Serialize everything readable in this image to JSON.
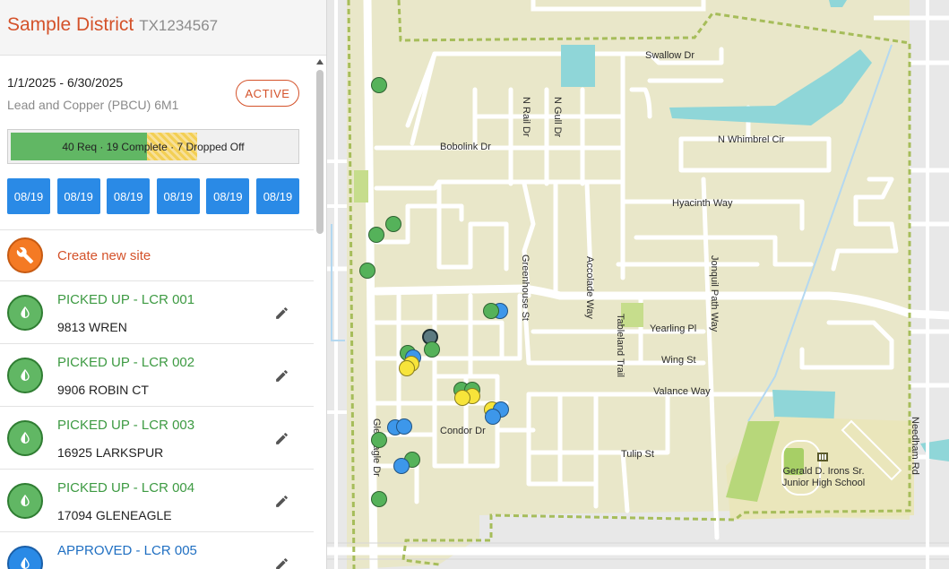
{
  "header": {
    "district_name": "Sample District",
    "district_id": "TX1234567"
  },
  "period": {
    "date_range": "1/1/2025 - 6/30/2025",
    "program": "Lead and Copper (PBCU) 6M1",
    "status_badge": "ACTIVE"
  },
  "progress": {
    "label": "40 Req · 19 Complete · 7 Dropped Off",
    "required": 40,
    "complete": 19,
    "dropped_off": 7,
    "colors": {
      "complete": "#61b764",
      "dropped": "#f3cf54"
    }
  },
  "dates": [
    "08/19",
    "08/19",
    "08/19",
    "08/19",
    "08/19",
    "08/19"
  ],
  "create_site": {
    "label": "Create new site",
    "icon": "wrench-icon"
  },
  "sites": [
    {
      "status": "PICKED UP - LCR 001",
      "address": "9813 WREN",
      "state": "picked-up"
    },
    {
      "status": "PICKED UP - LCR 002",
      "address": "9906 ROBIN CT",
      "state": "picked-up"
    },
    {
      "status": "PICKED UP - LCR 003",
      "address": "16925 LARKSPUR",
      "state": "picked-up"
    },
    {
      "status": "PICKED UP - LCR 004",
      "address": "17094 GLENEAGLE",
      "state": "picked-up"
    },
    {
      "status": "APPROVED - LCR 005",
      "address": "",
      "state": "approved"
    }
  ],
  "map": {
    "streets": {
      "swallow": "Swallow Dr",
      "n_rail": "N Rail Dr",
      "n_gull": "N Gull Dr",
      "bobolink": "Bobolink Dr",
      "n_whimbrel": "N Whimbrel Cir",
      "hyacinth": "Hyacinth Way",
      "greenhouse": "Greenhouse St",
      "accolade": "Accolade Way",
      "jonquil": "Jonquil Path Way",
      "tableland": "Tableland Trail",
      "yearling": "Yearling Pl",
      "wing": "Wing St",
      "valance": "Valance Way",
      "condor": "Condor Dr",
      "tulip": "Tulip St",
      "gleneagle": "Gleneagle Dr",
      "needham": "Needham Rd"
    },
    "school": "Gerald D. Irons Sr. Junior High School",
    "colors": {
      "area": "#e9e7c9",
      "boundary": "#a6bd5a",
      "water": "#8fd6d8",
      "marker_green": "#55b25a",
      "marker_blue": "#3d97ea",
      "marker_yellow": "#f7e43a"
    }
  }
}
